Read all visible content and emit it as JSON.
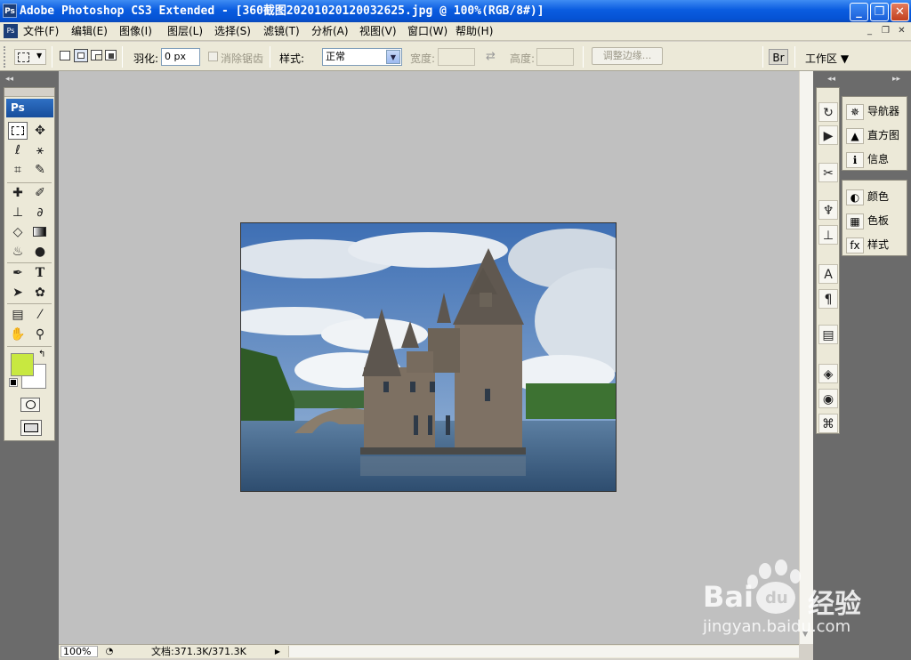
{
  "app": {
    "icon_text": "Ps",
    "title": "Adobe Photoshop CS3 Extended - [360截图20201020120032625.jpg @ 100%(RGB/8#)]"
  },
  "window_buttons": {
    "minimize": "_",
    "restore": "❐",
    "close": "✕"
  },
  "menu_icon": "Ps",
  "menus": [
    "文件(F)",
    "编辑(E)",
    "图像(I)",
    "图层(L)",
    "选择(S)",
    "滤镜(T)",
    "分析(A)",
    "视图(V)",
    "窗口(W)",
    "帮助(H)"
  ],
  "doc_buttons": {
    "minimize": "_",
    "restore": "❐",
    "close": "✕"
  },
  "options": {
    "feather_label": "羽化:",
    "feather_value": "0 px",
    "antialias_label": "消除锯齿",
    "style_label": "样式:",
    "style_value": "正常",
    "width_label": "宽度:",
    "height_label": "高度:",
    "refine_edge": "调整边缘...",
    "workspace": "工作区 ▼"
  },
  "toolbox": {
    "logo": "Ps"
  },
  "right_panels": {
    "navigator": "导航器",
    "histogram": "直方图",
    "info": "信息",
    "color": "颜色",
    "swatches": "色板",
    "styles": "样式"
  },
  "status": {
    "zoom": "100%",
    "doc": "文档:371.3K/371.3K"
  },
  "colors": {
    "foreground": "#c8e840",
    "background": "#ffffff",
    "workspace": "#c0c0c0"
  },
  "watermark": {
    "brand": "Bai",
    "paw": "du",
    "name": "经验",
    "url": "jingyan.baidu.com"
  }
}
